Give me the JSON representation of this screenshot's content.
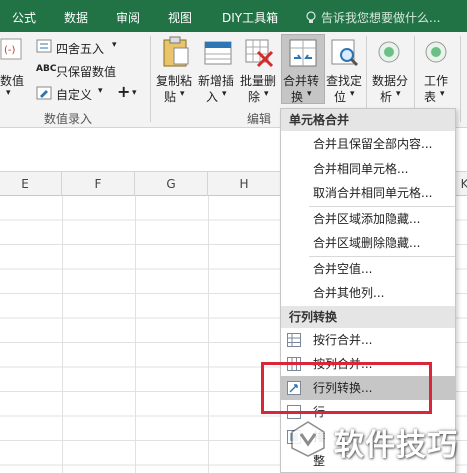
{
  "tabs": [
    "公式",
    "数据",
    "审阅",
    "视图",
    "DIY工具箱"
  ],
  "tell_me": "告诉我您想要做什么...",
  "ribbon": {
    "number_value_left": "数值",
    "round": "四舍五入",
    "keep_value": "只保留数值",
    "custom": "自定义",
    "plus_symbol": "+",
    "numeric_group_label": "数值录入",
    "copy_paste": [
      "复制粘",
      "贴"
    ],
    "insert_new": [
      "新增插",
      "入"
    ],
    "batch_delete": [
      "批量删",
      "除"
    ],
    "merge_convert": [
      "合并转",
      "换"
    ],
    "find_locate": [
      "查找定",
      "位"
    ],
    "edit_group_label": "编辑",
    "data_analysis": [
      "数据分",
      "析"
    ],
    "worksheet": [
      "工作",
      "表"
    ]
  },
  "columns": [
    "E",
    "F",
    "G",
    "H",
    "K"
  ],
  "menu": {
    "section_cells": "单元格合并",
    "items_cells": [
      "合并且保留全部内容...",
      "合并相同单元格...",
      "取消合并相同单元格...",
      "合并区域添加隐藏...",
      "合并区域删除隐藏...",
      "合并空值...",
      "合并其他列..."
    ],
    "section_rowcol": "行列转换",
    "items_rowcol": [
      "按行合并...",
      "按列合并...",
      "行列转换...",
      "行",
      "排",
      "整"
    ]
  },
  "watermark": "软件技巧",
  "colors": {
    "accent": "#217346",
    "highlight_border": "#d8263a",
    "hover": "#c6c6c6"
  }
}
